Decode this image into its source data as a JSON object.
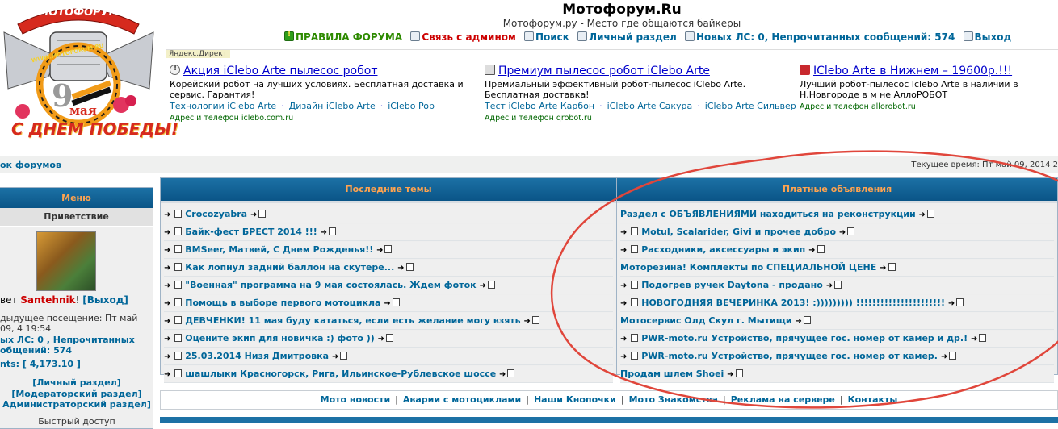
{
  "header": {
    "title": "Мотофорум.Ru",
    "tagline": "Мотофорум.ру - Место где общаются байкеры",
    "nav": [
      {
        "label": "ПРАВИЛА ФОРУМА",
        "icon": "rules-icon"
      },
      {
        "label": "Связь с админом",
        "icon": "contact-icon"
      },
      {
        "label": "Поиск",
        "icon": "search-icon"
      },
      {
        "label": "Личный раздел",
        "icon": "profile-icon"
      },
      {
        "label": "Новых ЛС: 0, Непрочитанных сообщений: 574",
        "icon": "messages-icon"
      },
      {
        "label": "Выход",
        "icon": "logout-icon"
      }
    ]
  },
  "logo": {
    "top_text": "МОТОФОРУМ",
    "url_text": "WWW.MOTOFORUM.RU",
    "day": "9",
    "month": "мая",
    "caption": "С ДНЕМ ПОБЕДЫ!"
  },
  "ads": {
    "label": "Яндекс.Директ",
    "items": [
      {
        "icon": "info-icon",
        "title": "Акция iClebo Arte пылесос робот",
        "text": "Корейский робот на лучших условиях. Бесплатная доставка и сервис. Гарантия!",
        "links": [
          "Технологии iClebo Arte",
          "Дизайн iClebo Arte",
          "iClebo Pop"
        ],
        "contact": "Адрес и телефон  iclebo.com.ru"
      },
      {
        "icon": "cart-icon",
        "title": "Премиум пылесос робот iClebo Arte",
        "text": "Премиальный эффективный робот-пылесос iClebo Arte. Бесплатная доставка!",
        "links": [
          "Тест iClebo Arte Карбон",
          "iClebo Arte Сакура",
          "iClebo Arte Сильвер"
        ],
        "contact": "Адрес и телефон  qrobot.ru"
      },
      {
        "icon": "shop-icon",
        "title": "IClebo Arte в Нижнем – 19600р.!!!",
        "text": "Лучший робот-пылесос Iclebo Arte в наличии в Н.Новгороде в м не АллоРОБОТ",
        "links": [],
        "contact": "Адрес и телефон  allorobot.ru"
      }
    ]
  },
  "crumb": "ок форумов",
  "current_time": "Текущее время: Пт май 09, 2014 2",
  "menu": {
    "title": "Меню",
    "subtitle": "Приветствие",
    "greet_prefix": "вет ",
    "username": "Santehnik",
    "greet_suffix": "! ",
    "logout": "[Выход]",
    "last_visit": "дыдущее посещение: Пт май 09, 4 19:54",
    "messages": "ых ЛС: 0 , Непрочитанных общений: 574",
    "points": "nts: [ 4,173.10 ]",
    "links": [
      "[Личный раздел]",
      "[Модераторский раздел]",
      "Администраторский раздел]"
    ],
    "quick": "Быстрый доступ"
  },
  "latest_topics": {
    "title": "Последние темы",
    "items": [
      "Crocozyabra",
      "Байк-фест БРЕСТ 2014 !!!",
      "BMSeer, Матвей, С Днем Рожденья!!",
      "Как лопнул задний баллон на скутере...",
      "\"Военная\" программа на 9 мая состоялась. Ждем фоток",
      "Помощь в выборе первого мотоцикла",
      "ДЕВЧЕНКИ! 11 мая буду кататься, если есть желание могу взять",
      "Оцените экип для новичка :) фото ))",
      "25.03.2014 Низя Дмитровка",
      "шашлыки Красногорск, Рига, Ильинское-Рублевское шоссе"
    ]
  },
  "paid_ads": {
    "title": "Платные объявления",
    "items": [
      {
        "text": "Раздел с ОБЪЯВЛЕНИЯМИ находиться на реконструкции",
        "arrow": false
      },
      {
        "text": "Motul, Scalarider, Givi и прочее добро",
        "arrow": true
      },
      {
        "text": "Расходники, аксессуары и экип",
        "arrow": true
      },
      {
        "text": "Моторезина! Комплекты по СПЕЦИАЛЬНОЙ ЦЕНЕ",
        "arrow": false
      },
      {
        "text": "Подогрев ручек Daytona - продано",
        "arrow": true
      },
      {
        "text": "НОВОГОДНЯЯ ВЕЧЕРИНКА 2013! :))))))))) !!!!!!!!!!!!!!!!!!!!!!",
        "arrow": true
      },
      {
        "text": "Мотосервис Олд Скул г. Мытищи",
        "arrow": false
      },
      {
        "text": "PWR-moto.ru Устройство, прячущее гос. номер от камер и др.!",
        "arrow": true
      },
      {
        "text": "PWR-moto.ru Устройство, прячущее гос. номер от камер.",
        "arrow": true
      },
      {
        "text": "Продам шлем Shoei",
        "arrow": false
      }
    ]
  },
  "bottom_nav": [
    "Мото новости",
    "Аварии с мотоциклами",
    "Наши Кнопочки",
    "Мото Знакомства",
    "Реклама на сервере",
    "Контакты"
  ],
  "colors": {
    "accent": "#006699",
    "header_bar": "#1c71a5",
    "header_text": "#ffa34f",
    "annotation": "#e0463b"
  }
}
